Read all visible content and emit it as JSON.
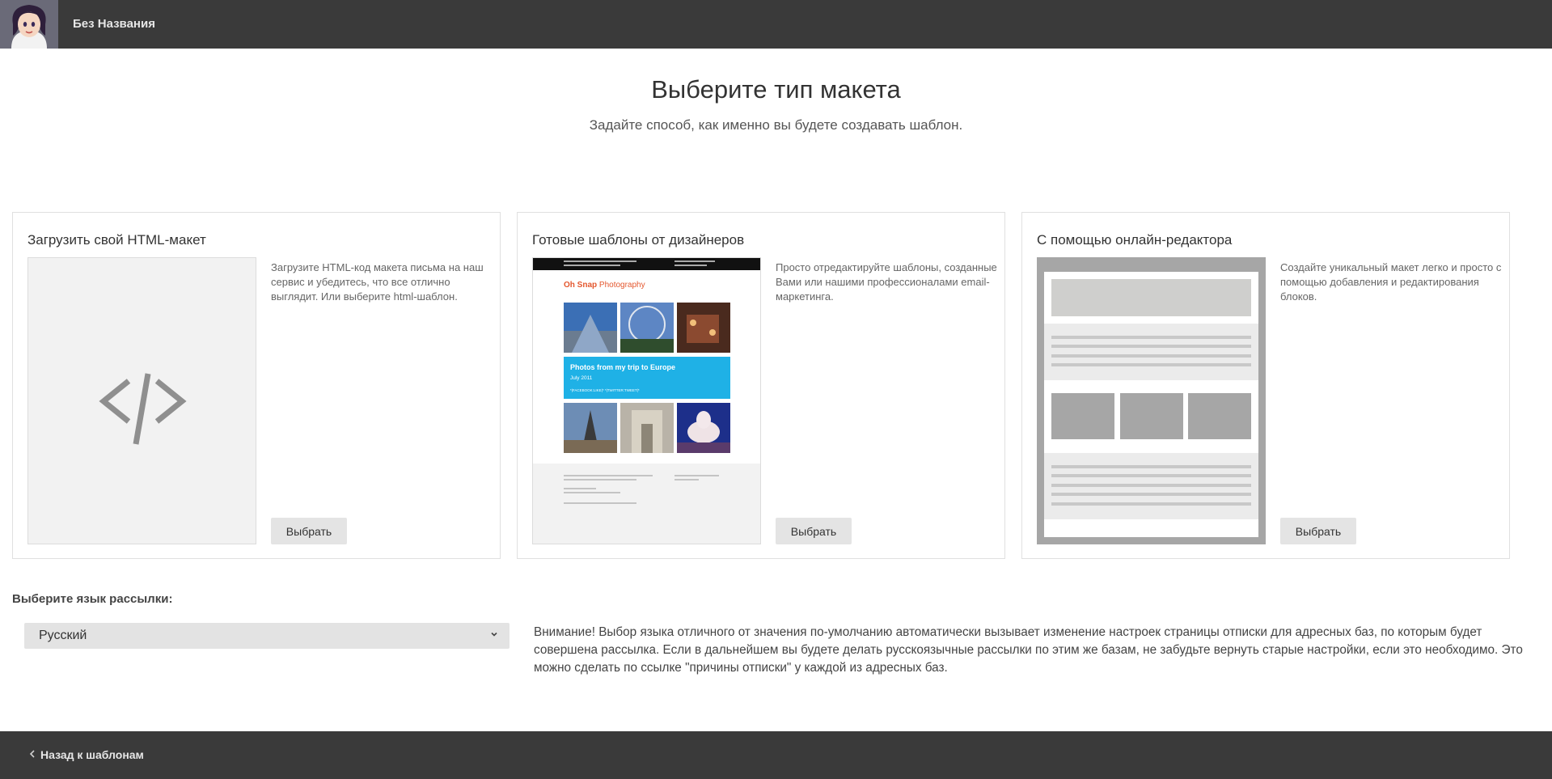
{
  "header": {
    "document_title": "Без Названия"
  },
  "main": {
    "title": "Выберите тип макета",
    "subtitle": "Задайте способ, как именно вы будете создавать шаблон."
  },
  "cards": [
    {
      "title": "Загрузить свой HTML-макет",
      "description": "Загрузите HTML-код макета письма на наш сервис и убедитесь, что все отлично выглядит. Или выберите html-шаблон.",
      "button": "Выбрать",
      "icon": "code-icon"
    },
    {
      "title": "Готовые шаблоны от дизайнеров",
      "description": "Просто отредактируйте шаблоны, созданные Вами или нашими профессионалами email-маркетинга.",
      "button": "Выбрать",
      "template_preview": {
        "brand_bold": "Oh Snap",
        "brand_rest": " Photography",
        "banner_title": "Photos from my trip to Europe",
        "banner_date": "July 2011",
        "banner_links": "*|FACEBOOK:LIKE|* *|TWITTER:TWEET|*"
      }
    },
    {
      "title": "С помощью онлайн-редактора",
      "description": "Создайте уникальный макет легко и просто с помощью добавления и редактирования блоков.",
      "button": "Выбрать"
    }
  ],
  "language": {
    "label": "Выберите язык рассылки:",
    "selected": "Русский",
    "warning": "Внимание! Выбор языка отличного от значения по-умолчанию автоматически вызывает изменение настроек страницы отписки для адресных баз, по которым будет совершена рассылка. Если в дальнейшем вы будете делать русскоязычные рассылки по этим же базам, не забудьте вернуть старые настройки, если это необходимо. Это можно сделать по ссылке \"причины отписки\" у каждой из адресных баз."
  },
  "footer": {
    "back_label": "Назад к шаблонам"
  },
  "colors": {
    "bar_background": "#3a3a3a",
    "button_background": "#e4e4e4",
    "banner_blue": "#1fb1e6",
    "brand_orange": "#e4572e"
  }
}
